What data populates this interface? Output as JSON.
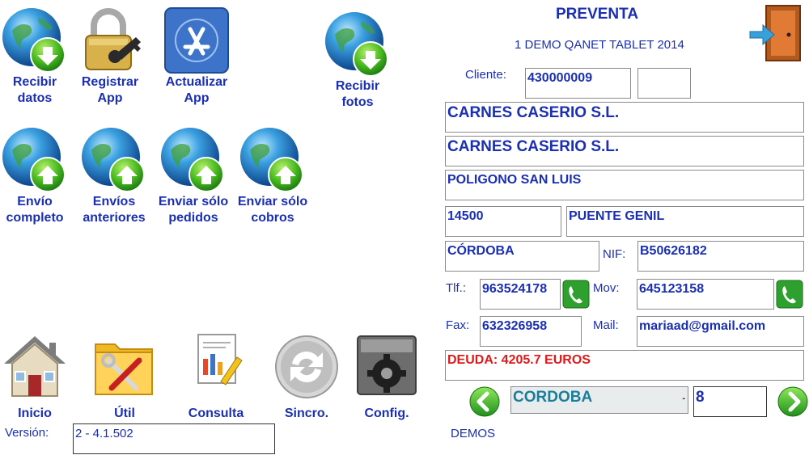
{
  "toolbar": {
    "recibir_datos": "Recibir\ndatos",
    "registrar_app": "Registrar\nApp",
    "actualizar_app": "Actualizar\nApp",
    "recibir_fotos": "Recibir\nfotos",
    "envio_completo": "Envío\ncompleto",
    "envios_anteriores": "Envíos\nanteriores",
    "enviar_pedidos": "Enviar sólo\npedidos",
    "enviar_cobros": "Enviar sólo\ncobros"
  },
  "bottom": {
    "inicio": "Inicio",
    "util": "Útil",
    "consulta": "Consulta",
    "sincro": "Sincro.",
    "config": "Config.",
    "version_label": "Versión:",
    "version_value": "2 - 4.1.502"
  },
  "form": {
    "title": "PREVENTA",
    "subtitle": "1 DEMO QANET TABLET 2014",
    "cliente_label": "Cliente:",
    "cliente_code": "430000009",
    "cliente_extra": "",
    "name1": "CARNES CASERIO S.L.",
    "name2": "CARNES CASERIO S.L.",
    "address": "POLIGONO SAN LUIS",
    "postal_code": "14500",
    "city": "PUENTE GENIL",
    "province": "CÓRDOBA",
    "nif_label": "NIF:",
    "nif": "B50626182",
    "tlf_label": "Tlf.:",
    "tlf": "963524178",
    "mov_label": "Mov:",
    "mov": "645123158",
    "fax_label": "Fax:",
    "fax": "632326958",
    "mail_label": "Mail:",
    "mail": "mariaad@gmail.com",
    "debt": "DEUDA: 4205.7 EUROS",
    "route_select": "CORDOBA",
    "route_number": "8",
    "demos": "DEMOS"
  },
  "colors": {
    "label_blue": "#1a2fb3",
    "debt_red": "#e01818",
    "green": "#2ea02e"
  }
}
